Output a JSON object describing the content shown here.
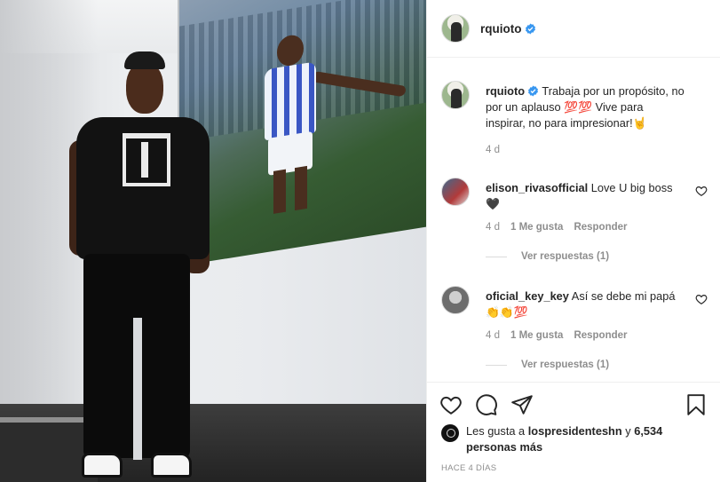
{
  "header": {
    "username": "rquioto",
    "verified_icon": "verified-badge-icon",
    "accent_color": "#3897f0"
  },
  "caption": {
    "username": "rquioto",
    "text": "Trabaja por un propósito, no por un aplauso 💯💯 Vive para inspirar, no para impresionar!🤘",
    "time": "4 d"
  },
  "comments": [
    {
      "username": "elison_rivasofficial",
      "text": "Love U big boss🖤",
      "time": "4 d",
      "likes": "1 Me gusta",
      "reply_label": "Responder",
      "view_replies": "Ver respuestas (1)"
    },
    {
      "username": "oficial_key_key",
      "text": "Así se debe mi papá 👏👏💯",
      "time": "4 d",
      "likes": "1 Me gusta",
      "reply_label": "Responder",
      "view_replies": "Ver respuestas (1)"
    }
  ],
  "actions": {
    "like_icon": "heart-icon",
    "comment_icon": "comment-icon",
    "share_icon": "share-icon",
    "save_icon": "bookmark-icon"
  },
  "likes": {
    "prefix": "Les gusta a",
    "user": "lospresidenteshn",
    "conjunction": "y",
    "others": "6,534 personas más"
  },
  "post_date": "HACE 4 DÍAS"
}
